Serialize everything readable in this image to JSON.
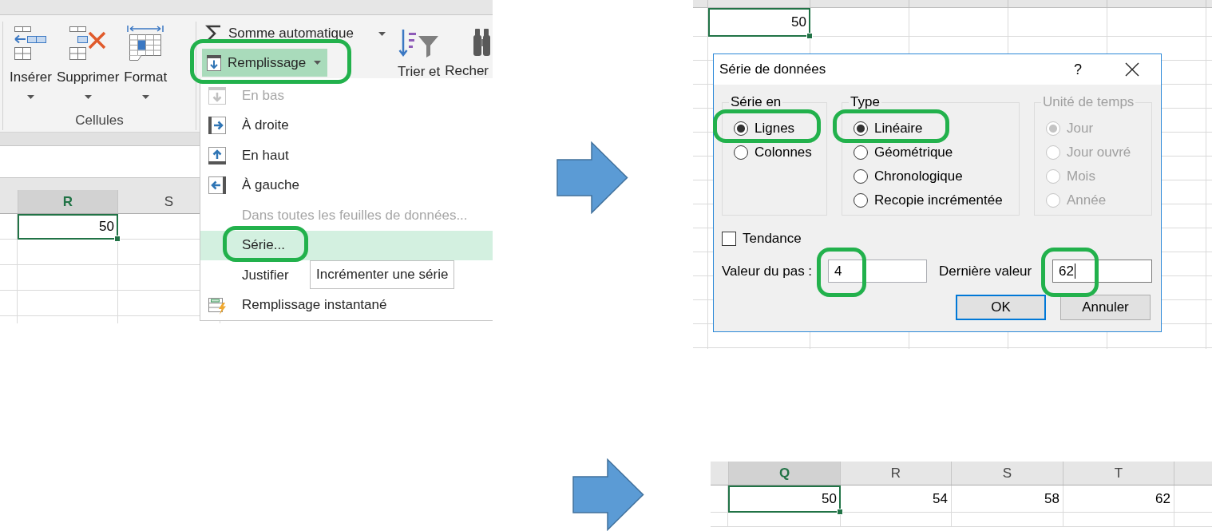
{
  "fill_menu_capture": {
    "ribbon": {
      "cell_buttons": [
        {
          "label": "Insérer",
          "kind": "insert"
        },
        {
          "label": "Supprimer",
          "kind": "delete"
        },
        {
          "label": "Format",
          "kind": "format"
        }
      ],
      "cells_group_label": "Cellules",
      "autosum": {
        "label": "Somme automatique"
      },
      "fill": {
        "label": "Remplissage",
        "expanded": true,
        "highlighted": true
      },
      "sort_filter": {
        "label": "Trier et"
      },
      "find": {
        "label": "Recher"
      }
    },
    "sheet": {
      "columns": [
        {
          "label": "R",
          "selected": true,
          "value": "50"
        },
        {
          "label": "S",
          "selected": false
        }
      ]
    },
    "fill_menu": {
      "items": [
        {
          "label": "En bas",
          "kind": "down",
          "disabled": true,
          "selected": false,
          "highlighted": false
        },
        {
          "label": "À droite",
          "kind": "right",
          "disabled": false,
          "selected": false,
          "highlighted": false
        },
        {
          "label": "En haut",
          "kind": "up",
          "disabled": false,
          "selected": false,
          "highlighted": false
        },
        {
          "label": "À gauche",
          "kind": "left",
          "disabled": false,
          "selected": false,
          "highlighted": false
        },
        {
          "label": "Dans toutes les feuilles de données...",
          "kind": "plain",
          "disabled": true,
          "selected": false,
          "highlighted": false
        },
        {
          "label": "Série...",
          "kind": "plain",
          "disabled": false,
          "selected": true,
          "highlighted": true
        },
        {
          "label": "Justifier",
          "kind": "plain",
          "disabled": false,
          "selected": false,
          "highlighted": false
        },
        {
          "label": "Remplissage instantané",
          "kind": "flash",
          "disabled": false,
          "selected": false,
          "highlighted": false
        }
      ]
    },
    "tooltip": "Incrémenter une série"
  },
  "series_dialog_capture": {
    "sheet": {
      "cells": [
        {
          "value": "50",
          "selected": true
        }
      ]
    },
    "dialog": {
      "title": "Série de données",
      "help": "?",
      "groups": [
        {
          "title": "Série en",
          "disabled": false,
          "options": [
            {
              "label": "Lignes",
              "selected": true,
              "highlighted": true
            },
            {
              "label": "Colonnes",
              "selected": false,
              "highlighted": false
            }
          ]
        },
        {
          "title": "Type",
          "disabled": false,
          "options": [
            {
              "label": "Linéaire",
              "selected": true,
              "highlighted": true
            },
            {
              "label": "Géométrique",
              "selected": false,
              "highlighted": false
            },
            {
              "label": "Chronologique",
              "selected": false,
              "highlighted": false
            },
            {
              "label": "Recopie incrémentée",
              "selected": false,
              "highlighted": false
            }
          ]
        },
        {
          "title": "Unité de temps",
          "disabled": true,
          "options": [
            {
              "label": "Jour",
              "selected": true,
              "highlighted": false
            },
            {
              "label": "Jour ouvré",
              "selected": false,
              "highlighted": false
            },
            {
              "label": "Mois",
              "selected": false,
              "highlighted": false
            },
            {
              "label": "Année",
              "selected": false,
              "highlighted": false
            }
          ]
        }
      ],
      "trend": {
        "label": "Tendance",
        "checked": false
      },
      "fields": [
        {
          "label": "Valeur du pas :",
          "value": "4",
          "focused": false,
          "highlighted": true
        },
        {
          "label": "Dernière valeur",
          "value": "62",
          "focused": true,
          "highlighted": true
        }
      ],
      "buttons": [
        {
          "label": "OK",
          "default": true
        },
        {
          "label": "Annuler",
          "default": false
        }
      ]
    }
  },
  "result_capture": {
    "sheet": {
      "columns": [
        {
          "label": "Q",
          "selected": true,
          "value": "50"
        },
        {
          "label": "R",
          "selected": false,
          "value": "54"
        },
        {
          "label": "S",
          "selected": false,
          "value": "58"
        },
        {
          "label": "T",
          "selected": false,
          "value": "62"
        }
      ]
    }
  }
}
